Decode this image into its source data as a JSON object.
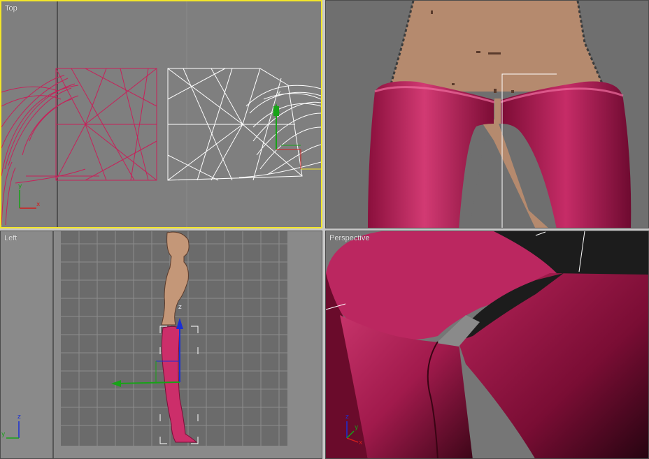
{
  "viewports": {
    "top": {
      "label": "Top",
      "axis_x": "x",
      "axis_y": "y"
    },
    "front": {
      "label": ""
    },
    "left": {
      "label": "Left",
      "axis_y": "y",
      "axis_z": "z"
    },
    "perspective": {
      "label": "Perspective",
      "axis_x": "x",
      "axis_y": "y",
      "axis_z": "z"
    }
  },
  "gizmo_labels": {
    "top_y": "y",
    "left_z": "z"
  },
  "colors": {
    "active_border": "#f3e628",
    "mesh_pink": "#c7215a",
    "wire_white": "#ffffff",
    "skin": "#b58a6e",
    "axis_x": "#d21d1d",
    "axis_y": "#17a317",
    "axis_z": "#1a2fd6"
  }
}
